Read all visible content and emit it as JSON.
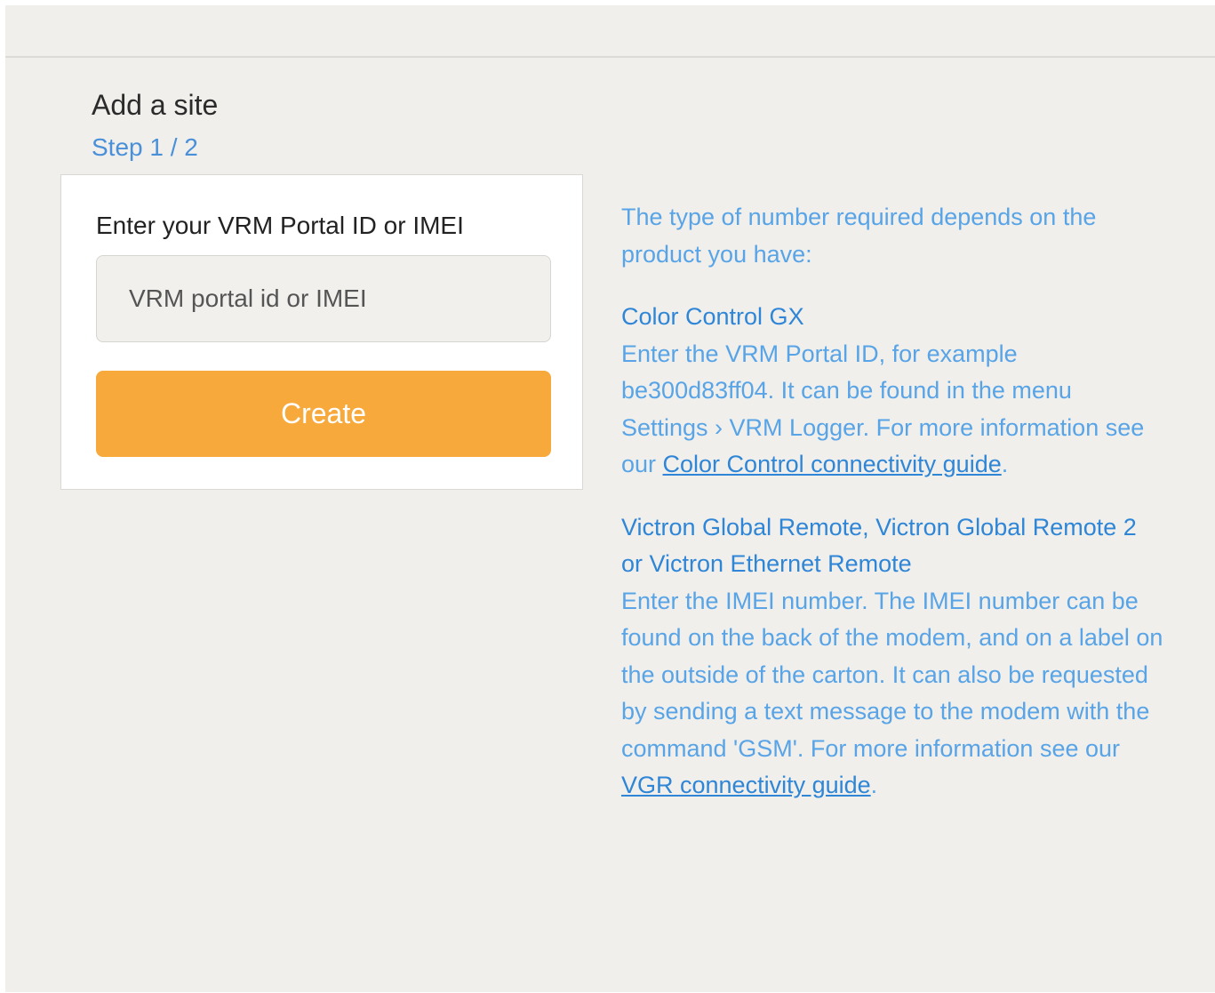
{
  "page": {
    "title": "Add a site",
    "step": "Step 1 / 2"
  },
  "form": {
    "label": "Enter your VRM Portal ID or IMEI",
    "input_placeholder": "VRM portal id or IMEI",
    "input_value": "",
    "create_label": "Create"
  },
  "help": {
    "intro": "The type of number required depends on the product you have:",
    "sections": [
      {
        "heading": "Color Control GX",
        "text": "Enter the VRM Portal ID, for example be300d83ff04. It can be found in the menu Settings › VRM Logger. For more information see our ",
        "link": "Color Control connectivity guide",
        "suffix": "."
      },
      {
        "heading": "Victron Global Remote, Victron Global Remote 2 or Victron Ethernet Remote",
        "text": "Enter the IMEI number. The IMEI number can be found on the back of the modem, and on a label on the outside of the carton. It can also be requested by sending a text message to the modem with the command 'GSM'. For more information see our ",
        "link": "VGR connectivity guide",
        "suffix": "."
      }
    ]
  },
  "colors": {
    "accent_button": "#f7a93c",
    "link_blue": "#2f86d6",
    "text_blue": "#58a4e6",
    "background": "#f0efec"
  }
}
